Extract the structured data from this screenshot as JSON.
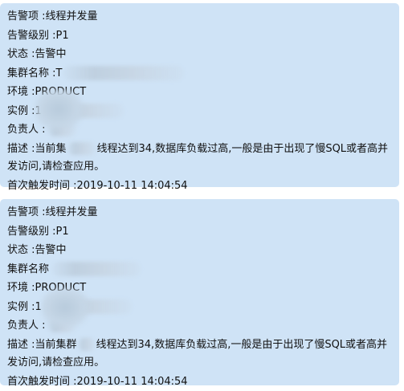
{
  "alerts": [
    {
      "alert_item": "告警项 :线程并发量",
      "alert_level": "告警级别 :P1",
      "status": "状态 :告警中",
      "cluster_name": "集群名称 :T",
      "environment": "环境 :PRODUCT",
      "instance": "实例 :1",
      "owner": "负责人 :",
      "description_a": "描述 :当前集",
      "description_b": "线程达到34,数据库负载过高,一般是由于出现了慢SQL或者高并发访问,请检查应用。",
      "first_triggered": "首次触发时间 :2019-10-11 14:04:54"
    },
    {
      "alert_item": "告警项 :线程并发量",
      "alert_level": "告警级别 :P1",
      "status": "状态 :告警中",
      "cluster_name": "集群名称",
      "environment": "环境 :PRODUCT",
      "instance": "实例 :1",
      "owner": "负责人 :",
      "description_a": "描述 :当前集群",
      "description_b": "线程达到34,数据库负载过高,一般是由于出现了慢SQL或者高并发访问,请检查应用。",
      "first_triggered": "首次触发时间 :2019-10-11 14:04:54"
    }
  ]
}
